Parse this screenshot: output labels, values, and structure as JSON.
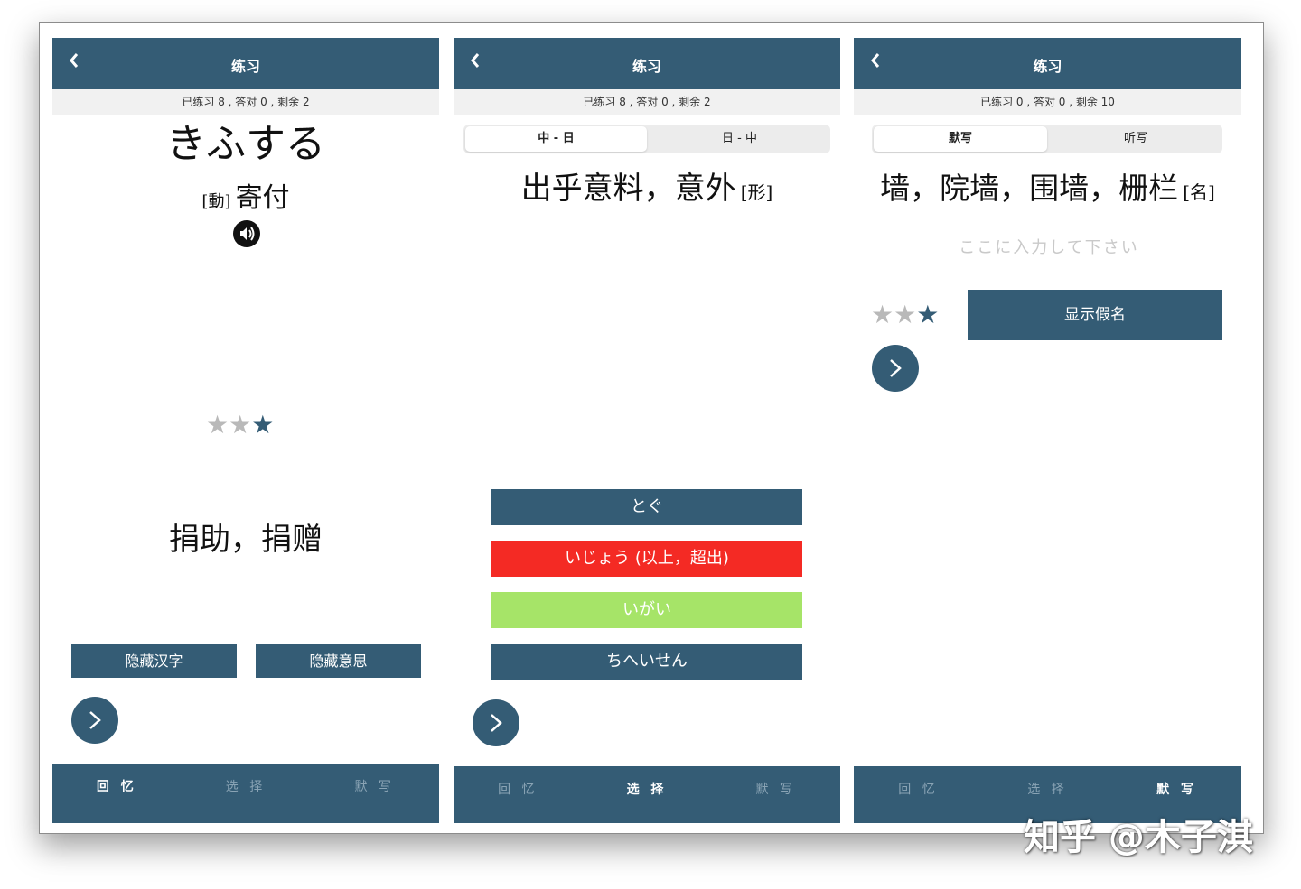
{
  "colors": {
    "primary": "#345c75",
    "wrong": "#f42a24",
    "correct": "#a6e468",
    "inactive_tab": "#8aa4b5"
  },
  "panel1": {
    "back_icon": "chevron-left-icon",
    "title": "练习",
    "stats": "已练习 8 , 答对 0 , 剩余 2",
    "kana": "きふする",
    "pos_tag": "[動]",
    "kanji": "寄付",
    "speaker_icon": "speaker-icon",
    "stars_on": 1,
    "meaning": "捐助，捐赠",
    "hide_kanji_label": "隐藏汉字",
    "hide_meaning_label": "隐藏意思",
    "next_icon": "chevron-right-icon",
    "tabs": [
      "回 忆",
      "选 择",
      "默 写"
    ],
    "active_tab": 0
  },
  "panel2": {
    "title": "练习",
    "stats": "已练习 8 , 答对 0 , 剩余 2",
    "seg": [
      "中 - 日",
      "日 - 中"
    ],
    "question": "出乎意料，意外",
    "pos_tag": "[形]",
    "options": [
      "とぐ",
      "いじょう (以上，超出)",
      "いがい",
      "ちへいせん"
    ],
    "tabs": [
      "回 忆",
      "选 择",
      "默 写"
    ],
    "active_tab": 1
  },
  "panel3": {
    "title": "练习",
    "stats": "已练习 0 , 答对 0 , 剩余 10",
    "seg": [
      "默写",
      "听写"
    ],
    "question": "墙，院墙，围墙，栅栏",
    "pos_tag": "[名]",
    "input_placeholder": "ここに入力して下さい",
    "stars_on": 1,
    "show_kana_label": "显示假名",
    "tabs": [
      "回 忆",
      "选 择",
      "默 写"
    ],
    "active_tab": 2
  },
  "watermark": "知乎 @木子淇"
}
